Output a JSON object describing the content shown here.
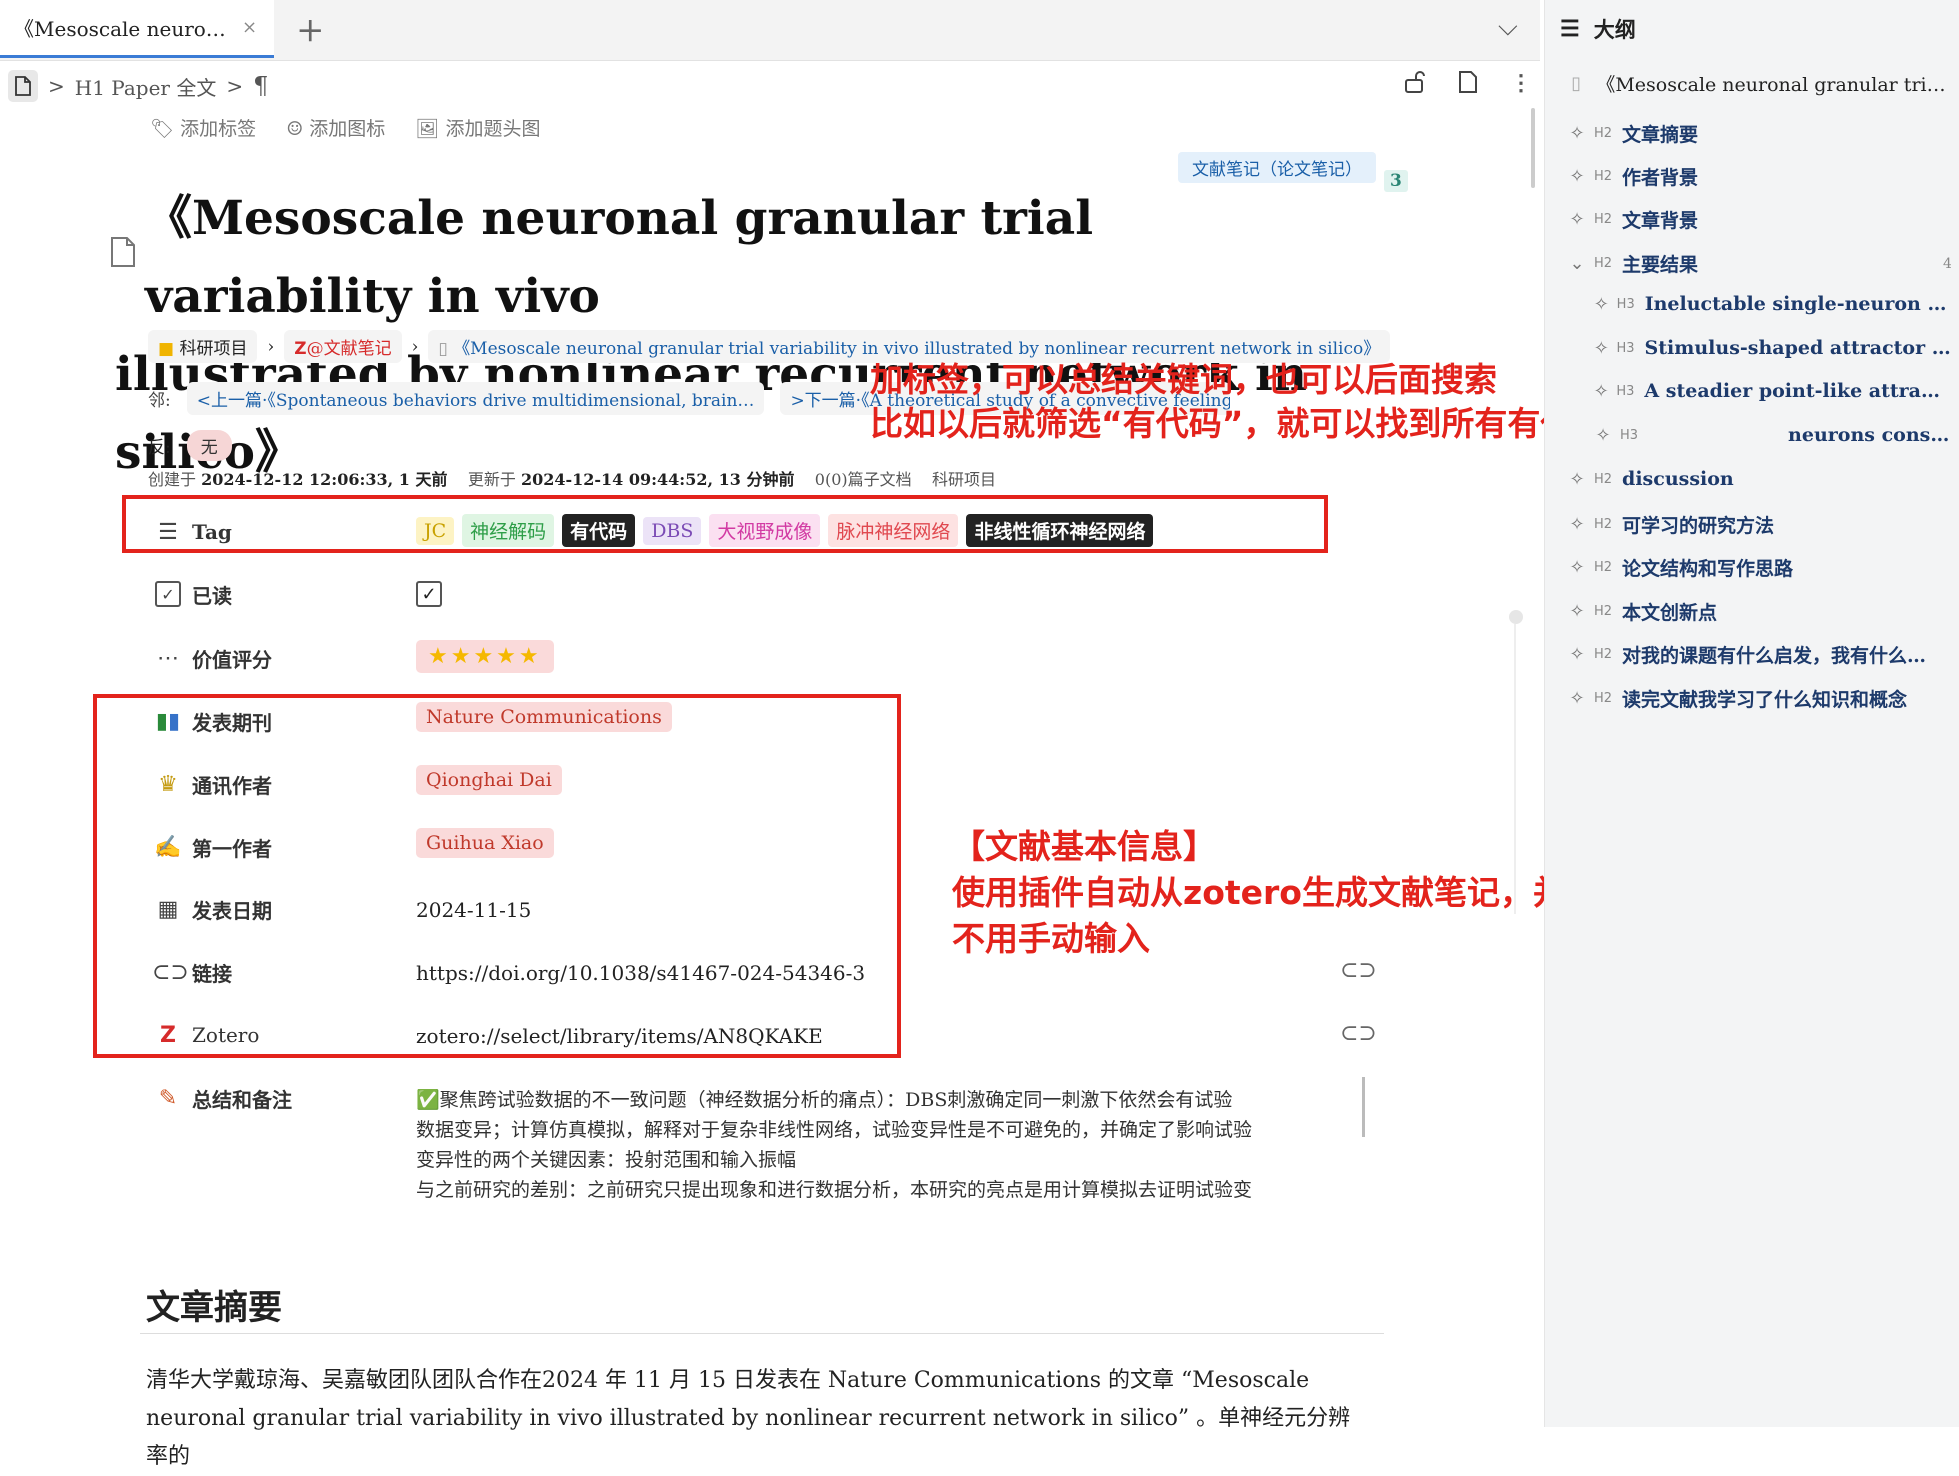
{
  "tab": {
    "title": "《Mesoscale neuronal granular trial variability in vivo illustrated by nonlinear recurrent network in silico》",
    "close": "×",
    "add": "+",
    "menu": "⌵"
  },
  "breadcrumb": {
    "sep": ">",
    "h1_label": "H1 Paper 全文",
    "para": "¶"
  },
  "add_row": {
    "tag": "添加标签",
    "icon": "添加图标",
    "header": "添加题头图"
  },
  "doc_note": "文献笔记（论文笔记）",
  "doc_note_count": "3",
  "title": {
    "line1": "《Mesoscale neuronal granular trial variability in vivo",
    "line2": "illustrated by nonlinear recurrent network in silico》"
  },
  "path": {
    "folder": "科研项目",
    "notebook": "@文献笔记",
    "doc": "《Mesoscale neuronal granular trial variability in vivo illustrated by nonlinear recurrent network in silico》"
  },
  "neighbors": {
    "label": "邻:",
    "prev": "<上一篇·《Spontaneous behaviors drive multidimensional, brain…",
    "next": ">下一篇·《A theoretical study of a convective feeling strategy for i"
  },
  "backlinks": {
    "label": "反:",
    "value": "无"
  },
  "meta": {
    "created_label": "创建于",
    "created": "2024-12-12 12:06:33, 1 天前",
    "updated_label": "更新于",
    "updated": "2024-12-14 09:44:52, 13 分钟前",
    "subdocs": "0(0)篇子文档",
    "notebook": "科研项目"
  },
  "attributes": {
    "tag_label": "Tag",
    "tags": [
      {
        "text": "JC",
        "bg": "#fdf3c4",
        "fg": "#c9a100"
      },
      {
        "text": "神经解码",
        "bg": "#dff5e3",
        "fg": "#2e9e48"
      },
      {
        "text": "有代码",
        "bg": "#222222",
        "fg": "#ffffff"
      },
      {
        "text": "DBS",
        "bg": "#ece3f7",
        "fg": "#7b4bb5"
      },
      {
        "text": "大视野成像",
        "bg": "#fbe0f1",
        "fg": "#d23aa3"
      },
      {
        "text": "脉冲神经网络",
        "bg": "#fde2e2",
        "fg": "#e0484f"
      },
      {
        "text": "非线性循环神经网络",
        "bg": "#222222",
        "fg": "#ffffff"
      }
    ],
    "read_label": "已读",
    "read_value": "✓",
    "rating_label": "价值评分",
    "rating_stars": "★★★★★",
    "rating_value": 5,
    "journal_label": "发表期刊",
    "journal": "Nature Communications",
    "corresponding_label": "通讯作者",
    "corresponding": "Qionghai Dai",
    "first_label": "第一作者",
    "first": "Guihua Xiao",
    "date_label": "发表日期",
    "date": "2024-11-15",
    "link_label": "链接",
    "link": "https://doi.org/10.1038/s41467-024-54346-3",
    "zotero_label": "Zotero",
    "zotero": "zotero://select/library/items/AN8QKAKE",
    "summary_label": "总结和备注",
    "summary": [
      "✅聚焦跨试验数据的不一致问题（神经数据分析的痛点）：DBS刺激确定同一刺激下依然会有试验",
      "数据变异；计算仿真模拟，解释对于复杂非线性网络，试验变异性是不可避免的，并确定了影响试验",
      "变异性的两个关键因素：投射范围和输入振幅",
      "与之前研究的差别：之前研究只提出现象和进行数据分析，本研究的亮点是用计算模拟去证明试验变"
    ]
  },
  "abstract": {
    "heading": "文章摘要",
    "text": "清华大学戴琼海、吴嘉敏团队团队合作在2024 年 11 月 15 日发表在 Nature Communications 的文章 “Mesoscale neuronal granular trial variability in vivo illustrated by nonlinear recurrent network in silico” 。单神经元分辨率的"
  },
  "annotations": {
    "tags_line1": "加标签，可以总结关键词，也可以后面搜索",
    "tags_line2": "比如以后就筛选“有代码”，就可以找到所有有代码的文章",
    "info_line1": "【文献基本信息】",
    "info_line2": "使用插件自动从zotero生成文献笔记，并自动添加信息",
    "info_line3": "不用手动输入"
  },
  "outline": {
    "title": "大纲",
    "items": [
      {
        "level": "",
        "text": "《Mesoscale neuronal granular trial v…"
      },
      {
        "level": "H2",
        "text": "文章摘要"
      },
      {
        "level": "H2",
        "text": "作者背景"
      },
      {
        "level": "H2",
        "text": "文章背景"
      },
      {
        "level": "H2",
        "text": "主要结果",
        "count": "4"
      },
      {
        "level": "H3",
        "text": "Ineluctable single-neuron and p…"
      },
      {
        "level": "H3",
        "text": "Stimulus-shaped attractor mode…"
      },
      {
        "level": "H3",
        "text": "A steadier point-like attractor re…"
      },
      {
        "level": "H3",
        "text": "neurons cons…"
      },
      {
        "level": "H2",
        "text": "discussion"
      },
      {
        "level": "H2",
        "text": "可学习的研究方法"
      },
      {
        "level": "H2",
        "text": "论文结构和写作思路"
      },
      {
        "level": "H2",
        "text": "本文创新点"
      },
      {
        "level": "H2",
        "text": "对我的课题有什么启发，我有什么…"
      },
      {
        "level": "H2",
        "text": "读完文献我学习了什么知识和概念"
      }
    ]
  }
}
